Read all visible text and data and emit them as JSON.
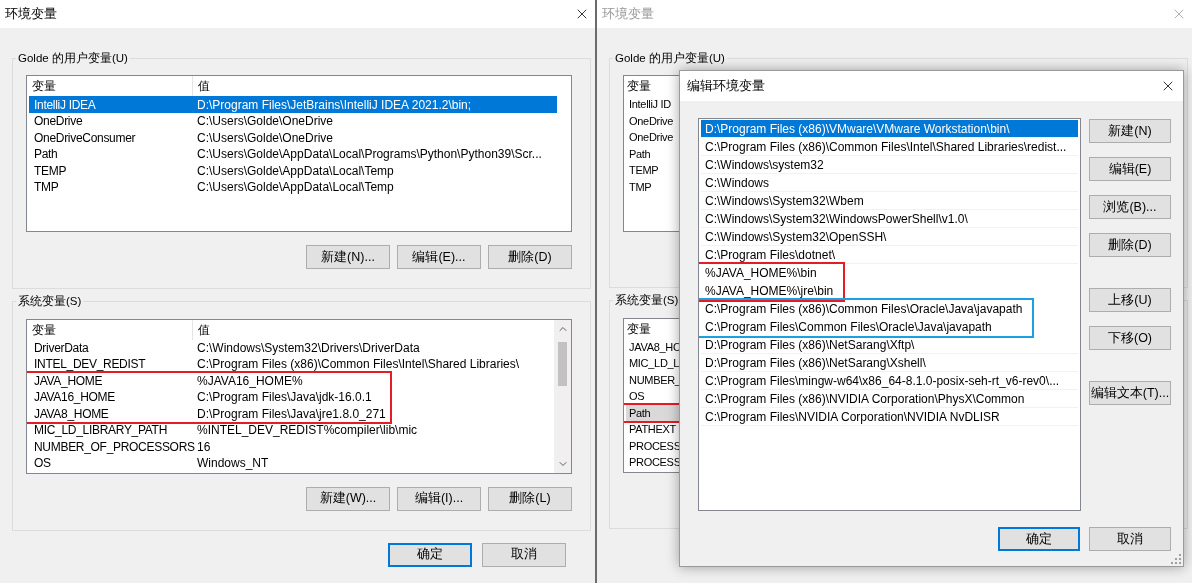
{
  "windows": [
    {
      "active": true,
      "title": "环境变量",
      "user_vars": {
        "label": "Golde 的用户变量(U)",
        "columns": [
          "变量",
          "值"
        ],
        "rows": [
          {
            "name": "IntelliJ IDEA",
            "value": "D:\\Program Files\\JetBrains\\IntelliJ IDEA 2021.2\\bin;",
            "selected": true
          },
          {
            "name": "OneDrive",
            "value": "C:\\Users\\Golde\\OneDrive",
            "selected": false
          },
          {
            "name": "OneDriveConsumer",
            "value": "C:\\Users\\Golde\\OneDrive",
            "selected": false
          },
          {
            "name": "Path",
            "value": "C:\\Users\\Golde\\AppData\\Local\\Programs\\Python\\Python39\\Scr...",
            "selected": false
          },
          {
            "name": "TEMP",
            "value": "C:\\Users\\Golde\\AppData\\Local\\Temp",
            "selected": false
          },
          {
            "name": "TMP",
            "value": "C:\\Users\\Golde\\AppData\\Local\\Temp",
            "selected": false
          }
        ],
        "buttons": [
          "新建(N)...",
          "编辑(E)...",
          "删除(D)"
        ]
      },
      "system_vars": {
        "label": "系统变量(S)",
        "columns": [
          "变量",
          "值"
        ],
        "scrollable": true,
        "rows": [
          {
            "name": "DriverData",
            "value": "C:\\Windows\\System32\\Drivers\\DriverData",
            "selected": false
          },
          {
            "name": "INTEL_DEV_REDIST",
            "value": "C:\\Program Files (x86)\\Common Files\\Intel\\Shared Libraries\\",
            "selected": false
          },
          {
            "name": "JAVA_HOME",
            "value": "%JAVA16_HOME%",
            "selected": false,
            "color": "#e51c23"
          },
          {
            "name": "JAVA16_HOME",
            "value": "C:\\Program Files\\Java\\jdk-16.0.1",
            "selected": false,
            "color": "#e51c23"
          },
          {
            "name": "JAVA8_HOME",
            "value": "D:\\Program Files\\Java\\jre1.8.0_271",
            "selected": false,
            "color": "#e51c23"
          },
          {
            "name": "MIC_LD_LIBRARY_PATH",
            "value": "%INTEL_DEV_REDIST%compiler\\lib\\mic",
            "selected": false
          },
          {
            "name": "NUMBER_OF_PROCESSORS",
            "value": "16",
            "selected": false
          },
          {
            "name": "OS",
            "value": "Windows_NT",
            "selected": false
          }
        ],
        "buttons": [
          "新建(W)...",
          "编辑(I)...",
          "删除(L)"
        ]
      },
      "buttons": [
        {
          "label": "确定",
          "default": true
        },
        {
          "label": "取消",
          "default": false
        }
      ]
    },
    {
      "active": false,
      "title": "环境变量",
      "user_vars": {
        "label": "Golde 的用户变量(U)",
        "columns": [
          "变量"
        ],
        "rows": [
          {
            "name": "IntelliJ ID",
            "selected": false
          },
          {
            "name": "OneDrive",
            "selected": false
          },
          {
            "name": "OneDrive",
            "selected": false
          },
          {
            "name": "Path",
            "selected": false
          },
          {
            "name": "TEMP",
            "selected": false
          },
          {
            "name": "TMP",
            "selected": false
          }
        ]
      },
      "system_vars": {
        "label": "系统变量(S)",
        "columns": [
          "变量"
        ],
        "rows": [
          {
            "name": "JAVA8_HO",
            "selected": false
          },
          {
            "name": "MIC_LD_L",
            "selected": false
          },
          {
            "name": "NUMBER_",
            "selected": false
          },
          {
            "name": "OS",
            "selected": false
          },
          {
            "name": "Path",
            "selected": true,
            "color": "#e51c23"
          },
          {
            "name": "PATHEXT",
            "selected": false
          },
          {
            "name": "PROCESS",
            "selected": false
          },
          {
            "name": "PROCESS",
            "selected": false
          }
        ]
      }
    }
  ],
  "dialog": {
    "title": "编辑环境变量",
    "entries": [
      {
        "text": "D:\\Program Files (x86)\\VMware\\VMware Workstation\\bin\\",
        "selected": true
      },
      {
        "text": "C:\\Program Files (x86)\\Common Files\\Intel\\Shared Libraries\\redist...",
        "selected": false
      },
      {
        "text": "C:\\Windows\\system32",
        "selected": false
      },
      {
        "text": "C:\\Windows",
        "selected": false
      },
      {
        "text": "C:\\Windows\\System32\\Wbem",
        "selected": false
      },
      {
        "text": "C:\\Windows\\System32\\WindowsPowerShell\\v1.0\\",
        "selected": false
      },
      {
        "text": "C:\\Windows\\System32\\OpenSSH\\",
        "selected": false
      },
      {
        "text": "C:\\Program Files\\dotnet\\",
        "selected": false
      },
      {
        "text": "%JAVA_HOME%\\bin",
        "selected": false,
        "color": "#e51c23"
      },
      {
        "text": "%JAVA_HOME%\\jre\\bin",
        "selected": false,
        "color": "#e51c23"
      },
      {
        "text": "C:\\Program Files (x86)\\Common Files\\Oracle\\Java\\javapath",
        "selected": false,
        "color": "#1ba1e2"
      },
      {
        "text": "C:\\Program Files\\Common Files\\Oracle\\Java\\javapath",
        "selected": false,
        "color": "#1ba1e2"
      },
      {
        "text": "D:\\Program Files (x86)\\NetSarang\\Xftp\\",
        "selected": false
      },
      {
        "text": "D:\\Program Files (x86)\\NetSarang\\Xshell\\",
        "selected": false
      },
      {
        "text": "C:\\Program Files\\mingw-w64\\x86_64-8.1.0-posix-seh-rt_v6-rev0\\...",
        "selected": false
      },
      {
        "text": "C:\\Program Files (x86)\\NVIDIA Corporation\\PhysX\\Common",
        "selected": false
      },
      {
        "text": "C:\\Program Files\\NVIDIA Corporation\\NVIDIA NvDLISR",
        "selected": false
      }
    ],
    "button_groups": [
      [
        "新建(N)",
        "编辑(E)",
        "浏览(B)...",
        "删除(D)"
      ],
      [
        "上移(U)",
        "下移(O)"
      ],
      [
        "编辑文本(T)..."
      ]
    ],
    "buttons": [
      {
        "label": "确定",
        "default": true
      },
      {
        "label": "取消",
        "default": false
      }
    ]
  }
}
